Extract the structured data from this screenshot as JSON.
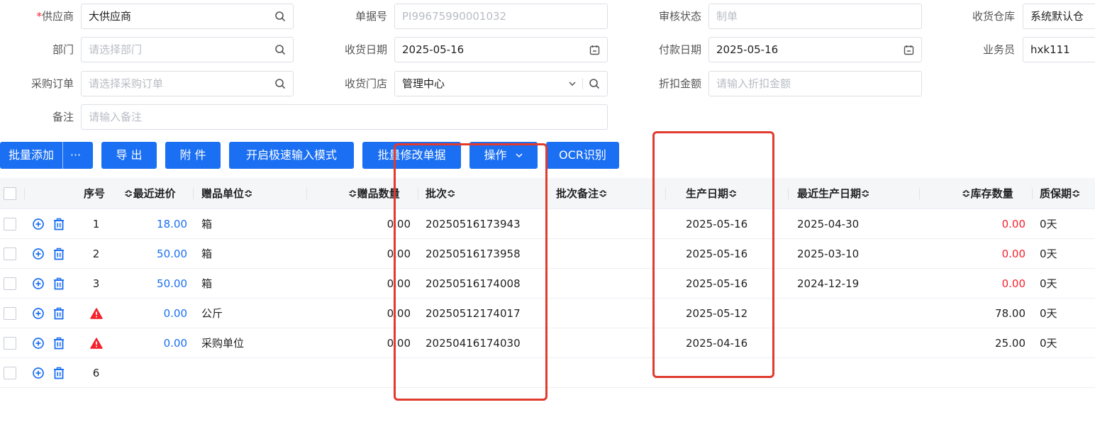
{
  "form": {
    "supplier": {
      "required_mark": "*",
      "label": "供应商",
      "value": "大供应商"
    },
    "doc_no": {
      "label": "单据号",
      "placeholder": "PI99675990001032"
    },
    "audit_status": {
      "label": "审核状态",
      "placeholder": "制单"
    },
    "warehouse": {
      "label": "收货仓库",
      "value": "系统默认仓"
    },
    "dept": {
      "label": "部门",
      "placeholder": "请选择部门"
    },
    "receive_date": {
      "label": "收货日期",
      "value": "2025-05-16"
    },
    "pay_date": {
      "label": "付款日期",
      "value": "2025-05-16"
    },
    "salesman": {
      "label": "业务员",
      "value": "hxk111"
    },
    "po": {
      "label": "采购订单",
      "placeholder": "请选择采购订单"
    },
    "store": {
      "label": "收货门店",
      "value": "管理中心"
    },
    "discount": {
      "label": "折扣金额",
      "placeholder": "请输入折扣金额"
    },
    "remark": {
      "label": "备注",
      "placeholder": "请输入备注"
    }
  },
  "toolbar": {
    "batch_add": "批量添加",
    "more": "···",
    "export": "导 出",
    "attach": "附 件",
    "fast_input": "开启极速输入模式",
    "batch_modify": "批量修改单据",
    "operate": "操作",
    "ocr": "OCR识别"
  },
  "table": {
    "headers": {
      "seq": "序号",
      "last_price": "最近进价",
      "gift_unit": "赠品单位",
      "gift_qty": "赠品数量",
      "batch": "批次",
      "batch_note": "批次备注",
      "prod_date": "生产日期",
      "last_prod_date": "最近生产日期",
      "stock_qty": "库存数量",
      "shelf_life": "质保期"
    },
    "rows": [
      {
        "seq": "1",
        "price": "18.00",
        "unit": "箱",
        "qty": "0.00",
        "batch": "20250516173943",
        "prod_date": "2025-05-16",
        "last_prod_date": "2025-04-30",
        "stock": "0.00",
        "shelf": "0天"
      },
      {
        "seq": "2",
        "price": "50.00",
        "unit": "箱",
        "qty": "0.00",
        "batch": "20250516173958",
        "prod_date": "2025-05-16",
        "last_prod_date": "2025-03-10",
        "stock": "0.00",
        "shelf": "0天"
      },
      {
        "seq": "3",
        "price": "50.00",
        "unit": "箱",
        "qty": "0.00",
        "batch": "20250516174008",
        "prod_date": "2025-05-16",
        "last_prod_date": "2024-12-19",
        "stock": "0.00",
        "shelf": "0天"
      },
      {
        "seq": "",
        "price": "0.00",
        "unit": "公斤",
        "qty": "0.00",
        "batch": "20250512174017",
        "prod_date": "2025-05-12",
        "last_prod_date": "",
        "stock": "78.00",
        "shelf": "0天"
      },
      {
        "seq": "",
        "price": "0.00",
        "unit": "采购单位",
        "qty": "0.00",
        "batch": "20250416174030",
        "prod_date": "2025-04-16",
        "last_prod_date": "",
        "stock": "25.00",
        "shelf": "0天"
      },
      {
        "seq": "6",
        "price": "",
        "unit": "",
        "qty": "",
        "batch": "",
        "prod_date": "",
        "last_prod_date": "",
        "stock": "",
        "shelf": ""
      }
    ]
  },
  "colors": {
    "primary": "#1a6ff2",
    "danger": "#f5222d",
    "highlight": "#e03b2e"
  },
  "icons": {
    "warning_rows": [
      3,
      4
    ]
  }
}
